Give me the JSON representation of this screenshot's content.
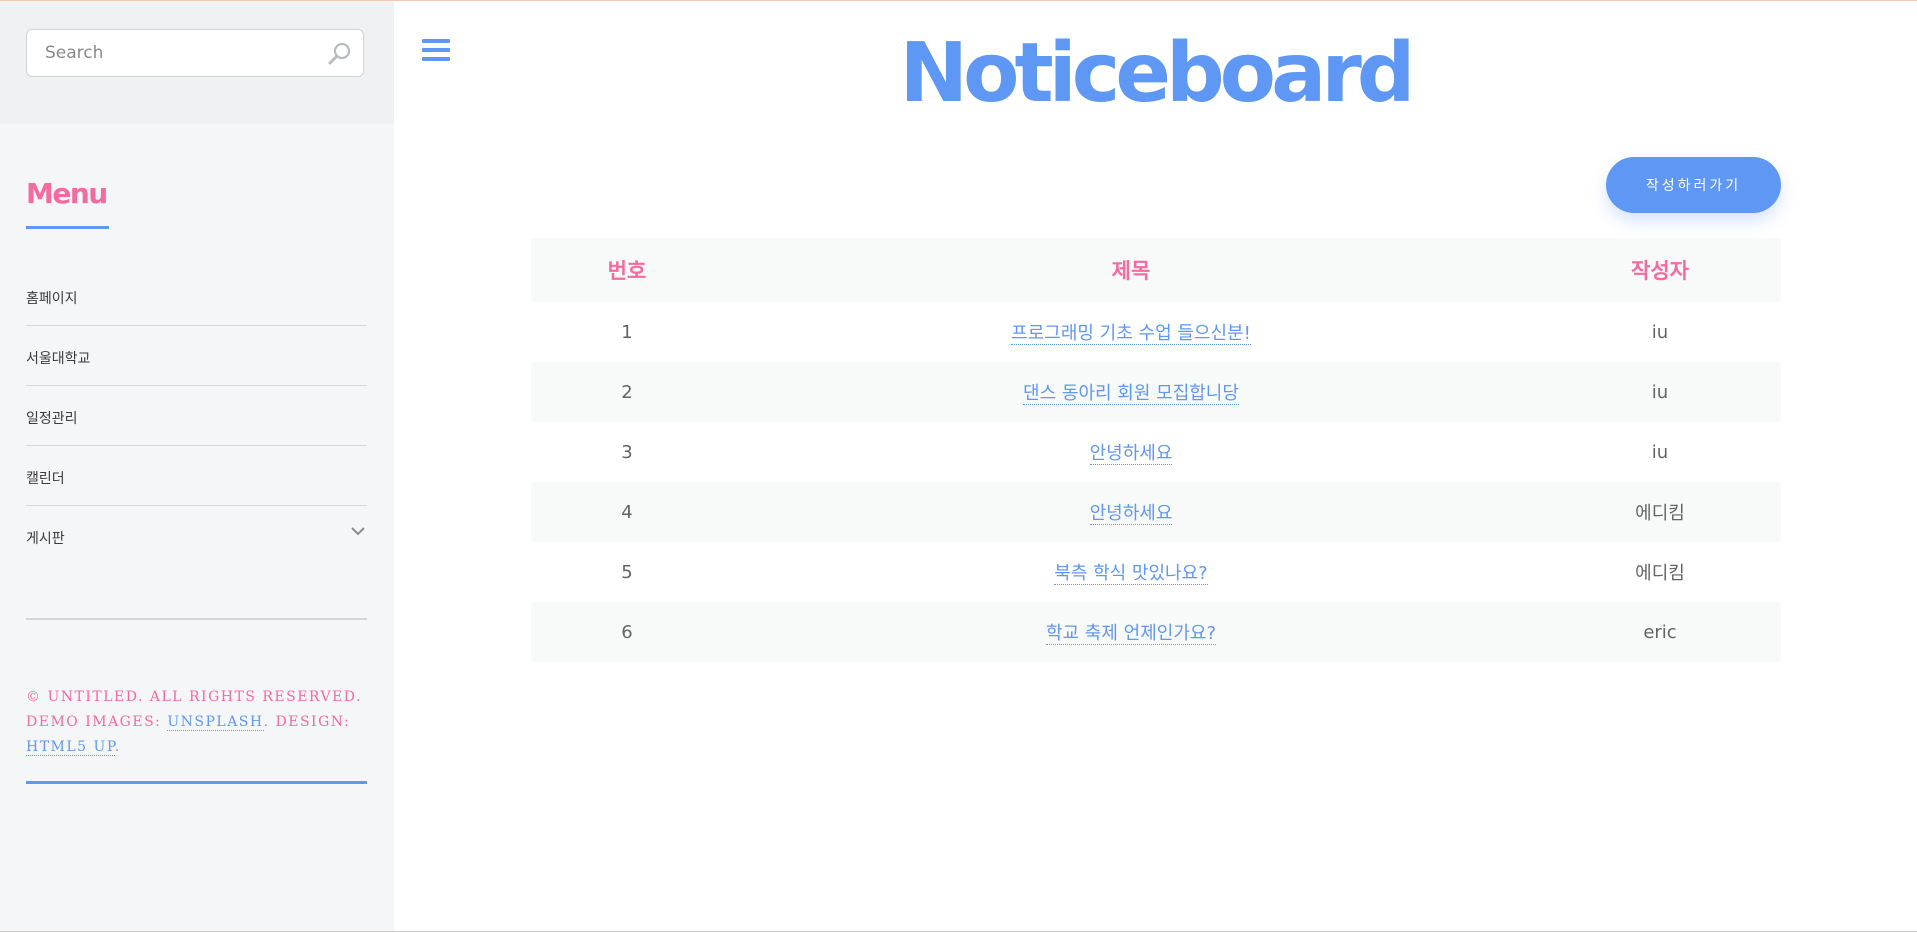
{
  "sidebar": {
    "search": {
      "placeholder": "Search",
      "icon": "search-icon"
    },
    "menu_title": "Menu",
    "items": [
      {
        "label": "홈페이지"
      },
      {
        "label": "서울대학교"
      },
      {
        "label": "일정관리"
      },
      {
        "label": "캘린더"
      },
      {
        "label": "게시판",
        "icon": "chevron-down-icon"
      }
    ],
    "footer": {
      "line1": "© Untitled. All rights reserved. Demo Images: ",
      "unsplash": "Unsplash",
      "line2": ". Design: ",
      "html5up": "HTML5 UP",
      "end": "."
    }
  },
  "header": {
    "menu_icon": "hamburger-icon",
    "title": "Noticeboard"
  },
  "main": {
    "write_button": "작성하러가기",
    "table": {
      "columns": [
        "번호",
        "제목",
        "작성자"
      ],
      "rows": [
        {
          "num": "1",
          "title": "프로그래밍 기초 수업 들으신분!",
          "author": "iu"
        },
        {
          "num": "2",
          "title": "댄스 동아리 회원 모집합니당",
          "author": "iu"
        },
        {
          "num": "3",
          "title": "안녕하세요",
          "author": "iu"
        },
        {
          "num": "4",
          "title": "안녕하세요",
          "author": "에디킴"
        },
        {
          "num": "5",
          "title": "북측 학식 맛있나요?",
          "author": "에디킴"
        },
        {
          "num": "6",
          "title": "학교 축제 언제인가요?",
          "author": "eric"
        }
      ]
    }
  },
  "colors": {
    "accent": "#5f97f5",
    "pink": "#f56a9f",
    "sidebar_bg": "#f5f6f7"
  }
}
